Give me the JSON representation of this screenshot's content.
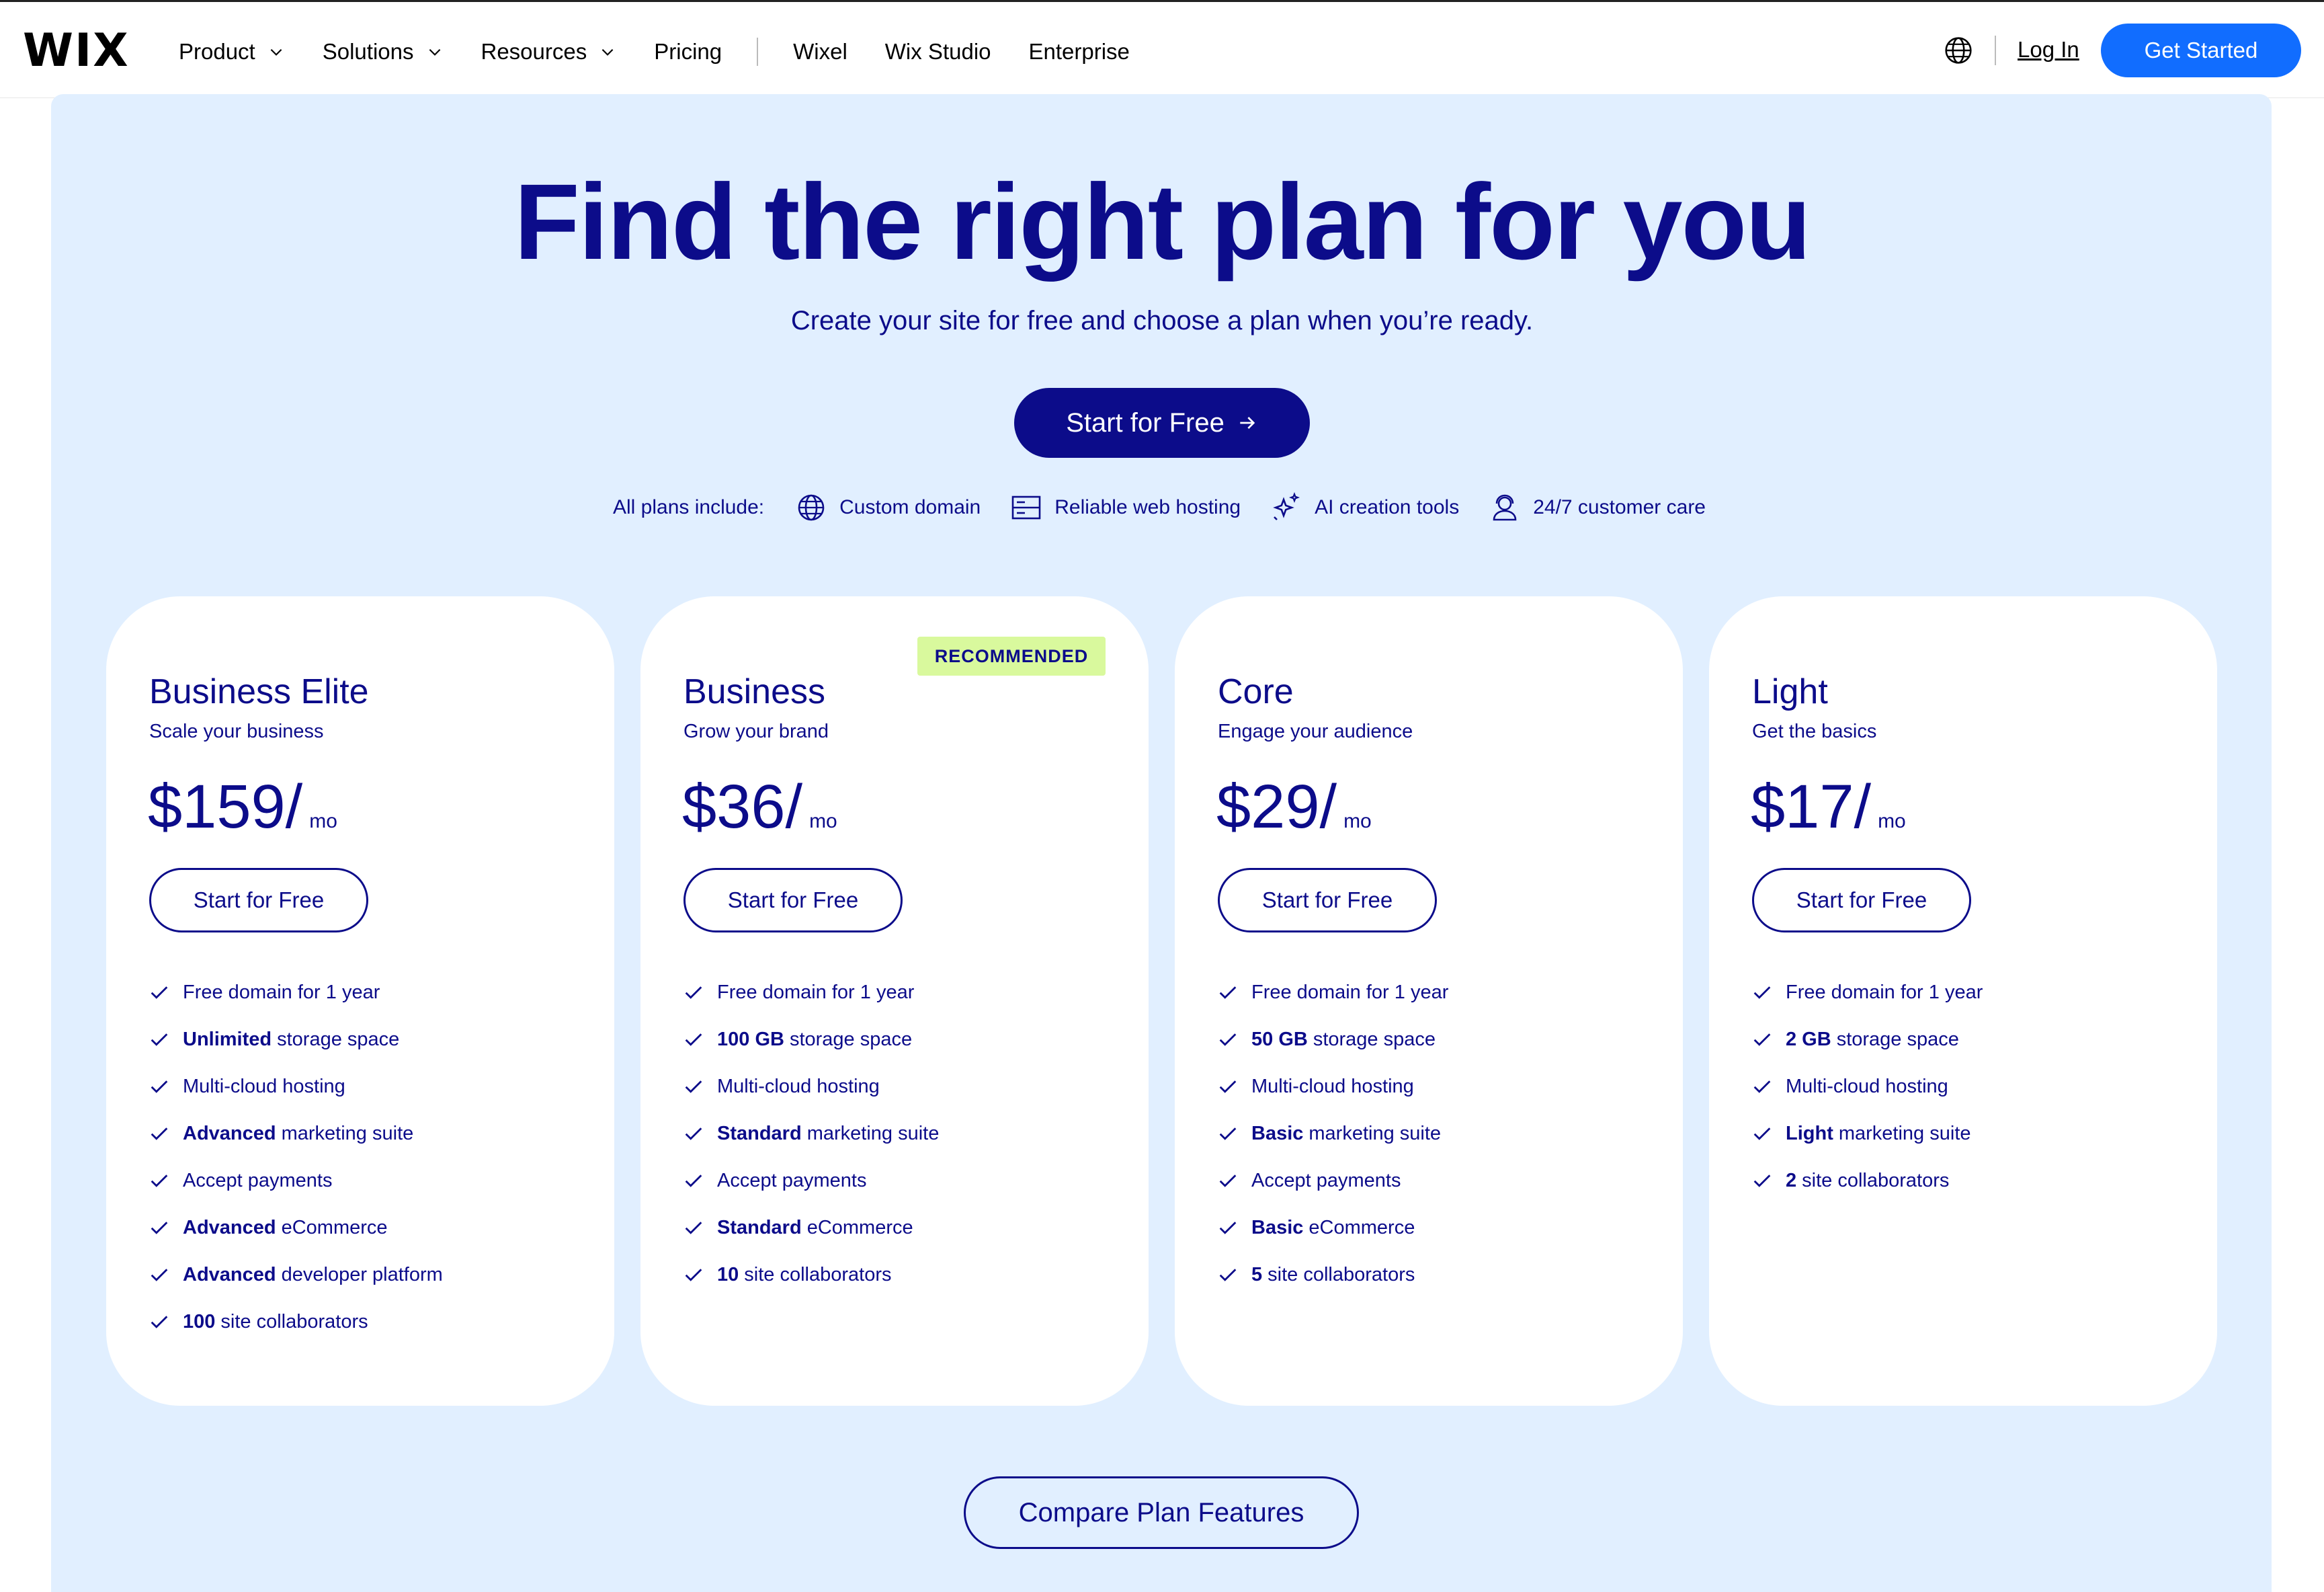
{
  "header": {
    "logo": "WIX",
    "nav": [
      {
        "label": "Product",
        "dropdown": true
      },
      {
        "label": "Solutions",
        "dropdown": true
      },
      {
        "label": "Resources",
        "dropdown": true
      },
      {
        "label": "Pricing",
        "dropdown": false
      }
    ],
    "nav_secondary": [
      "Wixel",
      "Wix Studio",
      "Enterprise"
    ],
    "login": "Log In",
    "get_started": "Get Started",
    "accent_color": "#116dff"
  },
  "hero": {
    "title": "Find the right plan for you",
    "subtitle": "Create your site for free and choose a plan when you’re ready.",
    "cta": "Start for Free",
    "includes_label": "All plans include:",
    "includes": [
      {
        "icon": "globe-icon",
        "label": "Custom domain"
      },
      {
        "icon": "server-icon",
        "label": "Reliable web hosting"
      },
      {
        "icon": "sparkle-icon",
        "label": "AI creation tools"
      },
      {
        "icon": "support-icon",
        "label": "24/7 customer care"
      }
    ],
    "background_color": "#e1efff",
    "text_color": "#0c0c8a"
  },
  "plans": [
    {
      "name": "Business Elite",
      "tagline": "Scale your business",
      "price": "$159",
      "slash": "/",
      "period": "mo",
      "badge": "",
      "button": "Start for Free",
      "features": [
        {
          "bold": "",
          "text": "Free domain for 1 year"
        },
        {
          "bold": "Unlimited",
          "text": "storage space"
        },
        {
          "bold": "",
          "text": "Multi-cloud hosting"
        },
        {
          "bold": "Advanced",
          "text": "marketing suite"
        },
        {
          "bold": "",
          "text": "Accept payments"
        },
        {
          "bold": "Advanced",
          "text": "eCommerce"
        },
        {
          "bold": "Advanced",
          "text": "developer platform"
        },
        {
          "bold": "100",
          "text": "site collaborators"
        }
      ]
    },
    {
      "name": "Business",
      "tagline": "Grow your brand",
      "price": "$36",
      "slash": "/",
      "period": "mo",
      "badge": "RECOMMENDED",
      "badge_color": "#d9f99d",
      "button": "Start for Free",
      "features": [
        {
          "bold": "",
          "text": "Free domain for 1 year"
        },
        {
          "bold": "100 GB",
          "text": "storage space"
        },
        {
          "bold": "",
          "text": "Multi-cloud hosting"
        },
        {
          "bold": "Standard",
          "text": "marketing suite"
        },
        {
          "bold": "",
          "text": "Accept payments"
        },
        {
          "bold": "Standard",
          "text": "eCommerce"
        },
        {
          "bold": "10",
          "text": "site collaborators"
        }
      ]
    },
    {
      "name": "Core",
      "tagline": "Engage your audience",
      "price": "$29",
      "slash": "/",
      "period": "mo",
      "badge": "",
      "button": "Start for Free",
      "features": [
        {
          "bold": "",
          "text": "Free domain for 1 year"
        },
        {
          "bold": "50 GB",
          "text": "storage space"
        },
        {
          "bold": "",
          "text": "Multi-cloud hosting"
        },
        {
          "bold": "Basic",
          "text": "marketing suite"
        },
        {
          "bold": "",
          "text": "Accept payments"
        },
        {
          "bold": "Basic",
          "text": "eCommerce"
        },
        {
          "bold": "5",
          "text": "site collaborators"
        }
      ]
    },
    {
      "name": "Light",
      "tagline": "Get the basics",
      "price": "$17",
      "slash": "/",
      "period": "mo",
      "badge": "",
      "button": "Start for Free",
      "features": [
        {
          "bold": "",
          "text": "Free domain for 1 year"
        },
        {
          "bold": "2 GB",
          "text": "storage space"
        },
        {
          "bold": "",
          "text": "Multi-cloud hosting"
        },
        {
          "bold": "Light",
          "text": "marketing suite"
        },
        {
          "bold": "2",
          "text": "site collaborators"
        }
      ]
    }
  ],
  "compare_button": "Compare Plan Features"
}
